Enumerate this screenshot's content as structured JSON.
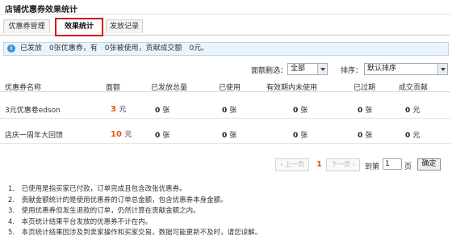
{
  "page_title": "店铺优惠券效果统计",
  "tabs": [
    "优惠券管理",
    "效果统计",
    "发放记录"
  ],
  "info_bar": {
    "text": "已发放　0张优惠券，有　0张被使用，贡献成交额　0元。",
    "accent": "#3d8fd6"
  },
  "filters": {
    "face_value_label": "面额删选：",
    "face_value_selected": "全部",
    "sort_label": "排序：",
    "sort_selected": "默认排序"
  },
  "table": {
    "headers": [
      "优惠券名称",
      "面额",
      "已发放总量",
      "已使用",
      "有效期内未使用",
      "已过期",
      "成交贡献"
    ],
    "rows": [
      {
        "name": "3元优惠卷edson",
        "price_num": "3",
        "price_unit": "元",
        "issued": "0",
        "used": "0",
        "unused": "0",
        "expired": "0",
        "contribution": "0",
        "unit": "张",
        "money_unit": "元"
      },
      {
        "name": "店庆一周年大回馈",
        "price_num": "10",
        "price_unit": "元",
        "issued": "0",
        "used": "0",
        "unused": "0",
        "expired": "0",
        "contribution": "0",
        "unit": "张",
        "money_unit": "元"
      }
    ]
  },
  "pagination": {
    "prev": "上一页",
    "current_page": "1",
    "next": "下一页",
    "goto_label": "到第",
    "goto_value": "1",
    "page_suffix": "页",
    "confirm": "确定"
  },
  "notes": [
    "1.　已使用是指买家已付款，订单完成且包含改张优惠券。",
    "2.　贡献金额统计的是使用优惠券的订单总金额，包含优惠券本身金额。",
    "3.　使用优惠券但发生退款的订单，仍然计算在贡献金额之内。",
    "4.　本页统计结果平台发放的优惠券不计在内。",
    "5.　本页统计结果因涉及到卖家操作和买家交易，数据可能更新不及时，请您谅解。"
  ],
  "colors": {
    "active_tab_border": "#d4151d",
    "price": "#e25b0c",
    "info_bg": "#eaf4fd"
  }
}
